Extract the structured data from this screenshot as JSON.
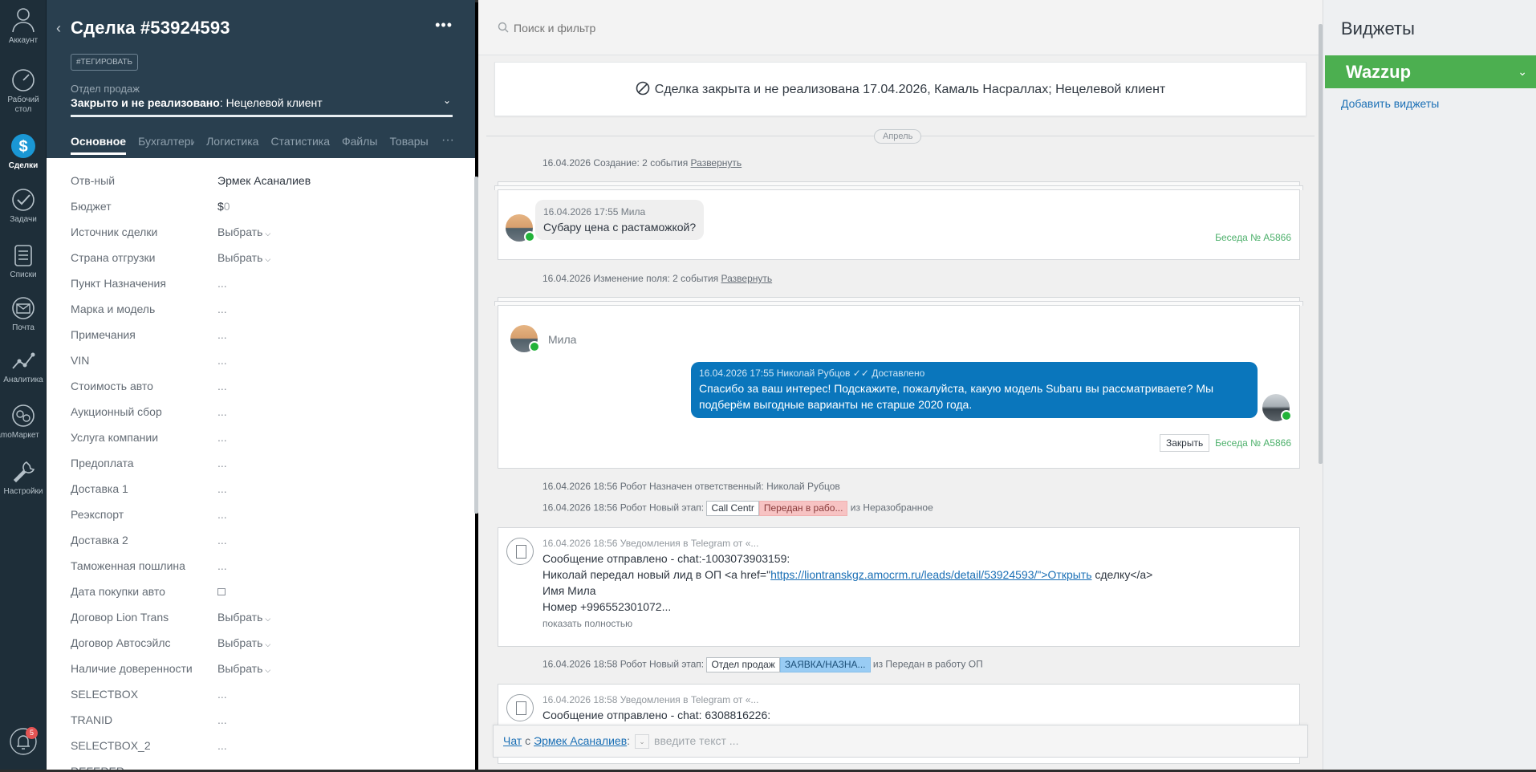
{
  "nav": {
    "items": [
      {
        "label": "Аккаунт",
        "icon": "user-icon"
      },
      {
        "label": "Рабочий стол",
        "icon": "speedometer-icon"
      },
      {
        "label": "Сделки",
        "icon": "dollar-icon"
      },
      {
        "label": "Задачи",
        "icon": "check-icon"
      },
      {
        "label": "Списки",
        "icon": "list-icon"
      },
      {
        "label": "Почта",
        "icon": "mail-icon"
      },
      {
        "label": "Аналитика",
        "icon": "analytics-icon"
      },
      {
        "label": "amoМаркет",
        "icon": "market-icon"
      },
      {
        "label": "Настройки",
        "icon": "wrench-icon"
      }
    ],
    "notifications_count": "5"
  },
  "deal": {
    "title": "Сделка #53924593",
    "tag_button": "#ТЕГИРОВАТЬ",
    "pipeline_label": "Отдел продаж",
    "status_prefix": "Закрыто и не реализовано",
    "status_reason": "Нецелевой клиент",
    "tabs": [
      "Основное",
      "Бухгалтерия",
      "Логистика",
      "Статистика",
      "Файлы",
      "Товары"
    ],
    "fields": [
      {
        "name": "Отв-ный",
        "value": "Эрмек Асаналиев",
        "kind": "text"
      },
      {
        "name": "Бюджет",
        "value": "$",
        "kind": "budget",
        "extra": "0"
      },
      {
        "name": "Источник сделки",
        "value": "Выбрать",
        "kind": "select"
      },
      {
        "name": "Страна отгрузки",
        "value": "Выбрать",
        "kind": "select"
      },
      {
        "name": "Пункт Назначения",
        "value": "...",
        "kind": "dots"
      },
      {
        "name": "Марка и модель",
        "value": "...",
        "kind": "dots"
      },
      {
        "name": "Примечания",
        "value": "...",
        "kind": "dots"
      },
      {
        "name": "VIN",
        "value": "...",
        "kind": "dots"
      },
      {
        "name": "Стоимость авто",
        "value": "...",
        "kind": "dots"
      },
      {
        "name": "Аукционный сбор",
        "value": "...",
        "kind": "dots"
      },
      {
        "name": "Услуга компании",
        "value": "...",
        "kind": "dots"
      },
      {
        "name": "Предоплата",
        "value": "...",
        "kind": "dots"
      },
      {
        "name": "Доставка 1",
        "value": "...",
        "kind": "dots"
      },
      {
        "name": "Реэкспорт",
        "value": "...",
        "kind": "dots"
      },
      {
        "name": "Доставка 2",
        "value": "...",
        "kind": "dots"
      },
      {
        "name": "Таможенная пошлина",
        "value": "...",
        "kind": "dots"
      },
      {
        "name": "Дата покупки авто",
        "value": "",
        "kind": "date"
      },
      {
        "name": "Договор Lion Trans",
        "value": "Выбрать",
        "kind": "select"
      },
      {
        "name": "Договор Автосэйлс",
        "value": "Выбрать",
        "kind": "select"
      },
      {
        "name": "Наличие доверенности",
        "value": "Выбрать",
        "kind": "select"
      },
      {
        "name": "SELECTBOX",
        "value": "...",
        "kind": "dots"
      },
      {
        "name": "TRANID",
        "value": "...",
        "kind": "dots"
      },
      {
        "name": "SELECTBOX_2",
        "value": "...",
        "kind": "dots"
      },
      {
        "name": "REFERER",
        "value": "",
        "kind": "dots"
      }
    ]
  },
  "feed": {
    "search_placeholder": "Поиск и фильтр",
    "closed_banner": "Сделка закрыта и не реализована 17.04.2026, Камаль Насраллах; Нецелевой клиент",
    "month": "Апрель",
    "group1": {
      "text": "16.04.2026 Создание: 2 события",
      "link": "Развернуть"
    },
    "msg1": {
      "meta": "16.04.2026 17:55 Мила",
      "text": "Субару цена с растаможкой?",
      "conversation": "Беседа № A5866"
    },
    "group2": {
      "text": "16.04.2026 Изменение поля: 2 события",
      "link": "Развернуть"
    },
    "msg2": {
      "sender": "Мила",
      "out_meta": "16.04.2026 17:55 Николай Рубцов",
      "out_status": "Доставлено",
      "out_text": "Спасибо за ваш интерес! Подскажите, пожалуйста, какую модель Subaru вы рассматриваете? Мы подберём выгодные варианты не старше 2020 года.",
      "close_button": "Закрыть",
      "conversation": "Беседа № A5866"
    },
    "robot1": "16.04.2026 18:56 Робот Назначен ответственный: Николай Рубцов",
    "robot2": {
      "prefix": "16.04.2026 18:56 Робот Новый этап:",
      "chip_a": "Call Centr",
      "chip_b": "Передан в рабо...",
      "suffix": "из Неразобранное"
    },
    "tg1": {
      "meta": "16.04.2026 18:56 Уведомления в Telegram от «...",
      "line1": "Сообщение отправлено - chat:-1003073903159:",
      "line2_pre": "Николай передал новый лид в ОП <a href=\"",
      "line2_link": "https://liontranskgz.amocrm.ru/leads/detail/53924593/\">Открыть",
      "line2_post": " сделку</a>",
      "line3": "Имя Мила",
      "line4": "Номер +996552301072...",
      "more": "показать полностью"
    },
    "robot3": {
      "prefix": "16.04.2026 18:58 Робот Новый этап:",
      "chip_a": "Отдел продаж",
      "chip_b": "ЗАЯВКА/НАЗНА...",
      "suffix": "из Передан в работу ОП"
    },
    "tg2": {
      "meta": "16.04.2026 18:58 Уведомления в Telegram от «...",
      "line1": "Сообщение отправлено - chat: 6308816226:"
    },
    "chat": {
      "link1": "Чат",
      "with": "с",
      "link2": "Эрмек Асаналиев",
      "colon": ":",
      "placeholder": "введите текст ..."
    }
  },
  "widgets": {
    "title": "Виджеты",
    "wazzup": "Wazzup",
    "add": "Добавить виджеты"
  },
  "colors": {
    "nav_bg": "#1e2e39",
    "deal_header": "#293f4f",
    "wazzup_green": "#4caf50",
    "bubble_blue": "#0a76bc"
  }
}
